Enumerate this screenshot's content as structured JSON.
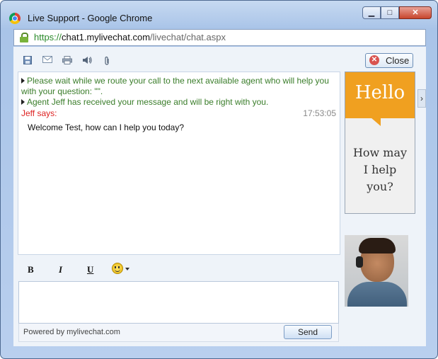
{
  "window": {
    "title": "Live Support - Google Chrome",
    "controls": {
      "minimize": "▁",
      "maximize": "□",
      "close": "✕"
    }
  },
  "address": {
    "scheme": "https://",
    "host": "chat1.mylivechat.com",
    "path": "/livechat/chat.aspx"
  },
  "toolbar": {
    "icons": [
      "save-icon",
      "email-icon",
      "print-icon",
      "sound-icon",
      "attach-icon"
    ],
    "close_label": "Close"
  },
  "chat": {
    "system_messages": [
      "Please wait while we route your call to the next available agent who will help you",
      "with your question: \"\".",
      "Agent Jeff has received your message and will be right with you."
    ],
    "sender": "Jeff says:",
    "time": "17:53:05",
    "message": "Welcome Test, how can I help you today?"
  },
  "format": {
    "bold": "B",
    "italic": "I",
    "underline": "U"
  },
  "footer": {
    "powered_by": "Powered by mylivechat.com",
    "send_label": "Send"
  },
  "banner": {
    "hello": "Hello",
    "line1": "How may",
    "line2": "I help",
    "line3": "you?"
  },
  "side_arrow": "›",
  "colors": {
    "system_text": "#3a7d2a",
    "sender_text": "#dd2222",
    "banner_orange": "#f0a020"
  }
}
